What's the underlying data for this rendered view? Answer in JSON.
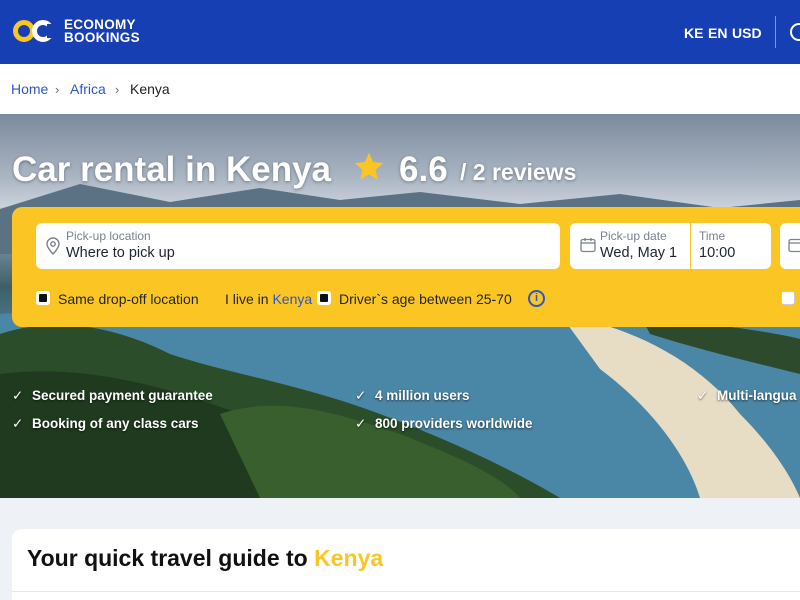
{
  "header": {
    "logo_line1": "ECONOMY",
    "logo_line2": "BOOKINGS",
    "country": "KE",
    "language": "EN",
    "currency": "USD",
    "logo_icon": "infinity-logo-icon",
    "account_icon": "user-icon"
  },
  "breadcrumb": {
    "items": [
      "Home",
      "Africa",
      "Kenya"
    ]
  },
  "hero": {
    "title": "Car rental in Kenya",
    "rating": "6.6",
    "reviews": "/ 2 reviews"
  },
  "search": {
    "pickup_location": {
      "label": "Pick-up location",
      "placeholder": "Where to pick up"
    },
    "pickup_date": {
      "label": "Pick-up date",
      "value": "Wed, May 1"
    },
    "time": {
      "label": "Time",
      "value": "10:00"
    },
    "same_dropoff": "Same drop-off location",
    "live_in_prefix": "I live in",
    "live_in_country": "Kenya",
    "drivers_age": "Driver`s age between 25-70"
  },
  "features": [
    "Secured payment guarantee",
    "Booking of any class cars",
    "4 million users",
    "800 providers worldwide",
    "Multi-langua"
  ],
  "guide": {
    "title_prefix": "Your quick travel guide to",
    "title_place": "Kenya"
  },
  "colors": {
    "header_blue": "#163fb4",
    "accent_yellow": "#fbc623",
    "link_blue": "#2c57c9"
  }
}
